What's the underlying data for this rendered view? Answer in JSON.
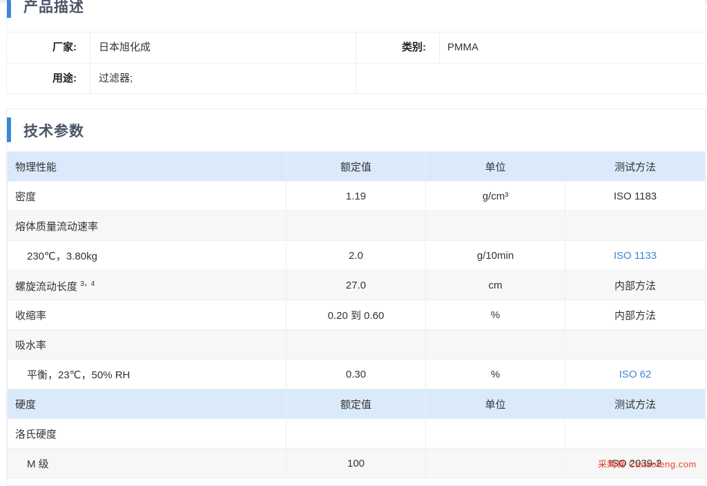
{
  "description": {
    "title": "产品描述",
    "fields": [
      {
        "label": "厂家:",
        "value": "日本旭化成"
      },
      {
        "label": "类别:",
        "value": "PMMA"
      },
      {
        "label": "用途:",
        "value": "过滤器;"
      }
    ]
  },
  "tech": {
    "title": "技术参数",
    "columns": [
      "物理性能",
      "额定值",
      "单位",
      "测试方法"
    ],
    "rows": [
      {
        "name": "密度",
        "value": "1.19",
        "unit": "g/cm³",
        "method": "ISO 1183"
      },
      {
        "name": "熔体质量流动速率",
        "value": "",
        "unit": "",
        "method": ""
      },
      {
        "name": "230℃，3.80kg",
        "value": "2.0",
        "unit": "g/10min",
        "method": "ISO 1133"
      },
      {
        "name": "螺旋流动长度",
        "sup": "3，4",
        "value": "27.0",
        "unit": "cm",
        "method": "内部方法"
      },
      {
        "name": "收缩率",
        "value": "0.20 到 0.60",
        "unit": "%",
        "method": "内部方法"
      },
      {
        "name": "吸水率",
        "value": "",
        "unit": "",
        "method": ""
      },
      {
        "name": "平衡，23℃，50% RH",
        "value": "0.30",
        "unit": "%",
        "method": "ISO 62"
      }
    ],
    "columns2": [
      "硬度",
      "额定值",
      "单位",
      "测试方法"
    ],
    "rows2": [
      {
        "name": "洛氏硬度",
        "value": "",
        "unit": "",
        "method": ""
      },
      {
        "name": "M 级",
        "value": "100",
        "unit": "",
        "method": "ISO 2039-2"
      }
    ]
  },
  "watermark": "采陶锋 Caitaofeng.com",
  "colors": {
    "accent": "#3b87d6",
    "header_bg": "#dbeafb",
    "link": "#3b87d6"
  }
}
